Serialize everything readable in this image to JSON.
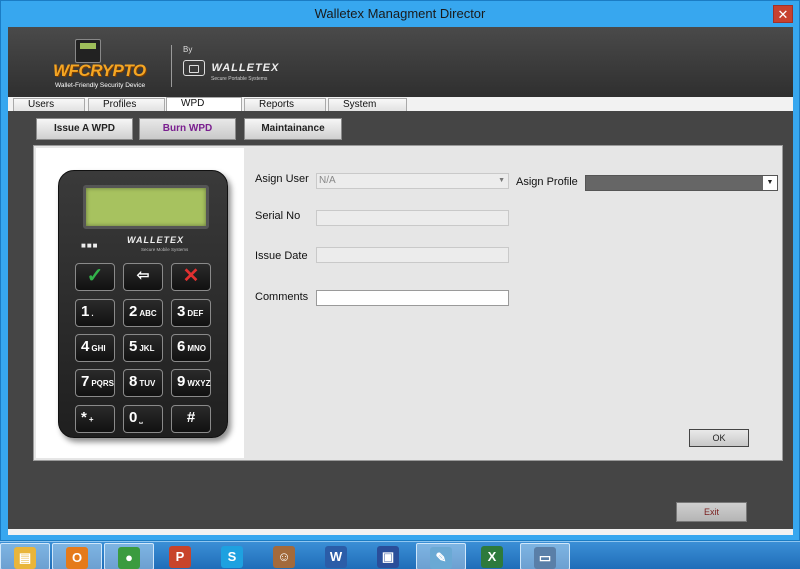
{
  "window": {
    "title": "Walletex Managment Director",
    "close": "✕"
  },
  "header": {
    "wf_logo_text": "WFCRYPTO",
    "wf_logo_sub": "Wallet-Friendly Security Device",
    "by": "By",
    "walletex_logo": "WALLETEX",
    "walletex_sub": "Secure Portable Systems"
  },
  "tabs": [
    {
      "label": "Users"
    },
    {
      "label": "Profiles"
    },
    {
      "label": "WPD"
    },
    {
      "label": "Reports"
    },
    {
      "label": "System"
    }
  ],
  "subtabs": [
    {
      "label": "Issue A WPD"
    },
    {
      "label": "Burn WPD"
    },
    {
      "label": "Maintainance"
    }
  ],
  "device": {
    "dots": "■■■",
    "brand": "WALLETEX",
    "brand_sub": "Secure Mobile Systems",
    "keys": {
      "ok": "✓",
      "back": "⇦",
      "cancel": "✕",
      "k1": "1",
      "k1s": ".",
      "k2": "2",
      "k2s": "ABC",
      "k3": "3",
      "k3s": "DEF",
      "k4": "4",
      "k4s": "GHI",
      "k5": "5",
      "k5s": "JKL",
      "k6": "6",
      "k6s": "MNO",
      "k7": "7",
      "k7s": "PQRS",
      "k8": "8",
      "k8s": "TUV",
      "k9": "9",
      "k9s": "WXYZ",
      "kstar": "*",
      "kstars": "+",
      "k0": "0",
      "k0s": "⎵",
      "khash": "#"
    }
  },
  "form": {
    "assign_user_label": "Asign User",
    "assign_user_value": "N/A",
    "assign_profile_label": "Asign Profile",
    "serial_label": "Serial No",
    "serial_value": "",
    "issue_date_label": "Issue Date",
    "issue_date_value": "",
    "comments_label": "Comments",
    "comments_value": "",
    "ok_label": "OK"
  },
  "footer": {
    "exit_label": "Exit"
  },
  "taskbar": {
    "items": [
      {
        "name": "file-explorer-icon",
        "glyph": "▤",
        "color": "#e9b53a"
      },
      {
        "name": "outlook-icon",
        "glyph": "O",
        "color": "#e57a1a"
      },
      {
        "name": "chrome-icon",
        "glyph": "●",
        "color": "#3b9b3f"
      },
      {
        "name": "powerpoint-icon",
        "glyph": "P",
        "color": "#c8442a"
      },
      {
        "name": "skype-icon",
        "glyph": "S",
        "color": "#1ea1e0"
      },
      {
        "name": "contacts-icon",
        "glyph": "☺",
        "color": "#a36a3c"
      },
      {
        "name": "word-icon",
        "glyph": "W",
        "color": "#2b5da8"
      },
      {
        "name": "remote-desktop-icon",
        "glyph": "▣",
        "color": "#2a4e9a"
      },
      {
        "name": "notepad-icon",
        "glyph": "✎",
        "color": "#6aa9d4"
      },
      {
        "name": "excel-icon",
        "glyph": "X",
        "color": "#2d7a3c"
      },
      {
        "name": "app-window-icon",
        "glyph": "▭",
        "color": "#5a7fa8"
      }
    ]
  }
}
